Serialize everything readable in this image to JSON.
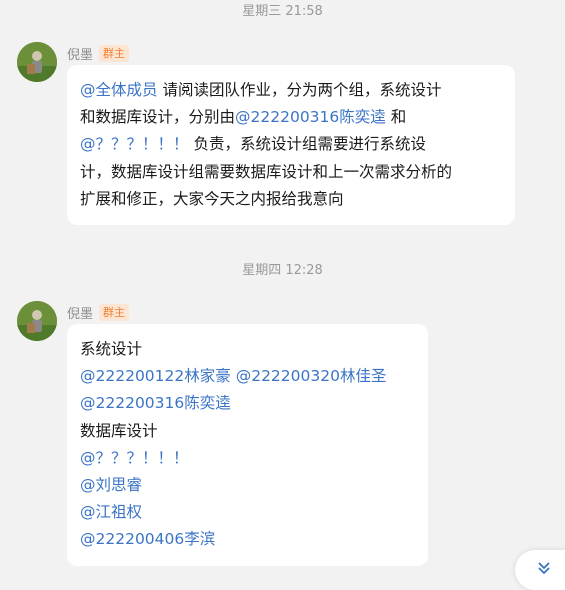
{
  "timestamps": {
    "first": "星期三 21:58",
    "second": "星期四 12:28"
  },
  "messages": [
    {
      "sender": "倪墨",
      "role": "群主",
      "lines": [
        [
          {
            "text": "@全体成员",
            "mention": true
          },
          {
            "text": " 请阅读团队作业，分为两个组，系统设计",
            "mention": false
          }
        ],
        [
          {
            "text": "和数据库设计，分别由",
            "mention": false
          },
          {
            "text": "@222200316陈奕逵",
            "mention": true
          },
          {
            "text": " 和",
            "mention": false
          }
        ],
        [
          {
            "text": "@？？？！！！",
            "mention": true
          },
          {
            "text": " 负责，系统设计组需要进行系统设",
            "mention": false
          }
        ],
        [
          {
            "text": "计，数据库设计组需要数据库设计和上一次需求分析的",
            "mention": false
          }
        ],
        [
          {
            "text": "扩展和修正，大家今天之内报给我意向",
            "mention": false
          }
        ]
      ]
    },
    {
      "sender": "倪墨",
      "role": "群主",
      "lines": [
        [
          {
            "text": "系统设计",
            "mention": false
          }
        ],
        [
          {
            "text": "@222200122林家豪",
            "mention": true
          },
          {
            "text": " ",
            "mention": false
          },
          {
            "text": "@222200320林佳圣",
            "mention": true
          }
        ],
        [
          {
            "text": "@222200316陈奕逵",
            "mention": true
          }
        ],
        [
          {
            "text": "数据库设计",
            "mention": false
          }
        ],
        [
          {
            "text": "@？？？！！！",
            "mention": true
          }
        ],
        [
          {
            "text": "@刘思睿",
            "mention": true
          }
        ],
        [
          {
            "text": "@江祖权",
            "mention": true
          }
        ],
        [
          {
            "text": "@222200406李滨",
            "mention": true
          }
        ]
      ]
    }
  ],
  "scroll_button": {
    "icon": "double-chevron-down-icon",
    "color": "#3b74c6"
  },
  "colors": {
    "background": "#f2f2f2",
    "bubble": "#ffffff",
    "mention": "#3b74c6",
    "badge_text": "#f07f2e",
    "badge_bg": "#fde5d3"
  }
}
